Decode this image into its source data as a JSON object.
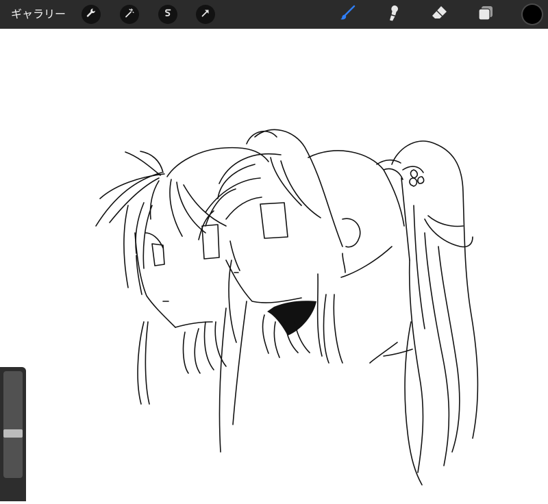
{
  "toolbar": {
    "gallery_label": "ギャラリー",
    "left_tools": [
      {
        "icon": "wrench-icon"
      },
      {
        "icon": "magic-wand-icon"
      },
      {
        "icon": "selection-icon"
      },
      {
        "icon": "transform-arrow-icon"
      }
    ],
    "right_tools": [
      {
        "icon": "brush-icon",
        "active": true
      },
      {
        "icon": "smudge-icon",
        "active": false
      },
      {
        "icon": "eraser-icon",
        "active": false
      },
      {
        "icon": "layers-icon",
        "active": false
      }
    ],
    "current_color": "#000000",
    "active_tool_color": "#2f7ef5"
  },
  "canvas": {
    "background": "#ffffff",
    "content": "line-art-sketch"
  }
}
